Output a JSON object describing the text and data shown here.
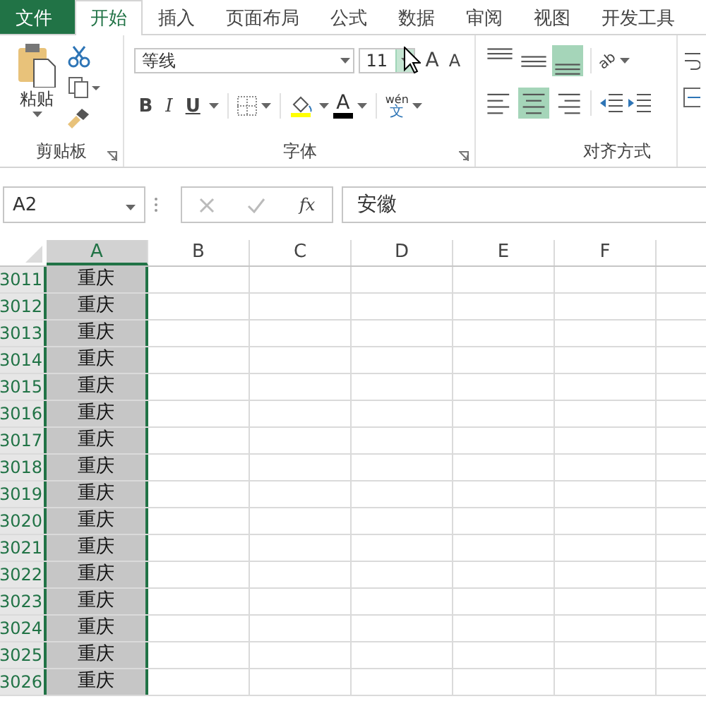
{
  "tabs": [
    {
      "label": "文件",
      "kind": "file",
      "selected": false
    },
    {
      "label": "开始",
      "kind": "tab",
      "selected": true
    },
    {
      "label": "插入",
      "kind": "tab",
      "selected": false
    },
    {
      "label": "页面布局",
      "kind": "tab",
      "selected": false
    },
    {
      "label": "公式",
      "kind": "tab",
      "selected": false
    },
    {
      "label": "数据",
      "kind": "tab",
      "selected": false
    },
    {
      "label": "审阅",
      "kind": "tab",
      "selected": false
    },
    {
      "label": "视图",
      "kind": "tab",
      "selected": false
    },
    {
      "label": "开发工具",
      "kind": "tab",
      "selected": false
    }
  ],
  "clipboard": {
    "paste_label": "粘贴",
    "group_label": "剪贴板"
  },
  "font": {
    "name": "等线",
    "size": "11",
    "grow": "A",
    "shrink": "A",
    "bold": "B",
    "italic": "I",
    "underline": "U",
    "color_letter": "A",
    "phonetic_top": "wén",
    "phonetic_bottom": "文",
    "group_label": "字体"
  },
  "alignment": {
    "vertical": [
      {
        "kind": "top",
        "selected": false
      },
      {
        "kind": "middle",
        "selected": false
      },
      {
        "kind": "bottom",
        "selected": true
      }
    ],
    "horizontal": [
      {
        "kind": "left",
        "selected": false
      },
      {
        "kind": "center",
        "selected": true
      },
      {
        "kind": "right",
        "selected": false
      }
    ],
    "orientation": "ab",
    "group_label": "对齐方式"
  },
  "formula_bar": {
    "name_box": "A2",
    "fx": "fx",
    "value": "安徽"
  },
  "columns": [
    {
      "label": "A",
      "selected": true
    },
    {
      "label": "B",
      "selected": false
    },
    {
      "label": "C",
      "selected": false
    },
    {
      "label": "D",
      "selected": false
    },
    {
      "label": "E",
      "selected": false
    },
    {
      "label": "F",
      "selected": false
    }
  ],
  "rows": [
    {
      "number": "3011",
      "value": "重庆"
    },
    {
      "number": "3012",
      "value": "重庆"
    },
    {
      "number": "3013",
      "value": "重庆"
    },
    {
      "number": "3014",
      "value": "重庆"
    },
    {
      "number": "3015",
      "value": "重庆"
    },
    {
      "number": "3016",
      "value": "重庆"
    },
    {
      "number": "3017",
      "value": "重庆"
    },
    {
      "number": "3018",
      "value": "重庆"
    },
    {
      "number": "3019",
      "value": "重庆"
    },
    {
      "number": "3020",
      "value": "重庆"
    },
    {
      "number": "3021",
      "value": "重庆"
    },
    {
      "number": "3022",
      "value": "重庆"
    },
    {
      "number": "3023",
      "value": "重庆"
    },
    {
      "number": "3024",
      "value": "重庆"
    },
    {
      "number": "3025",
      "value": "重庆"
    },
    {
      "number": "3026",
      "value": "重庆"
    }
  ]
}
